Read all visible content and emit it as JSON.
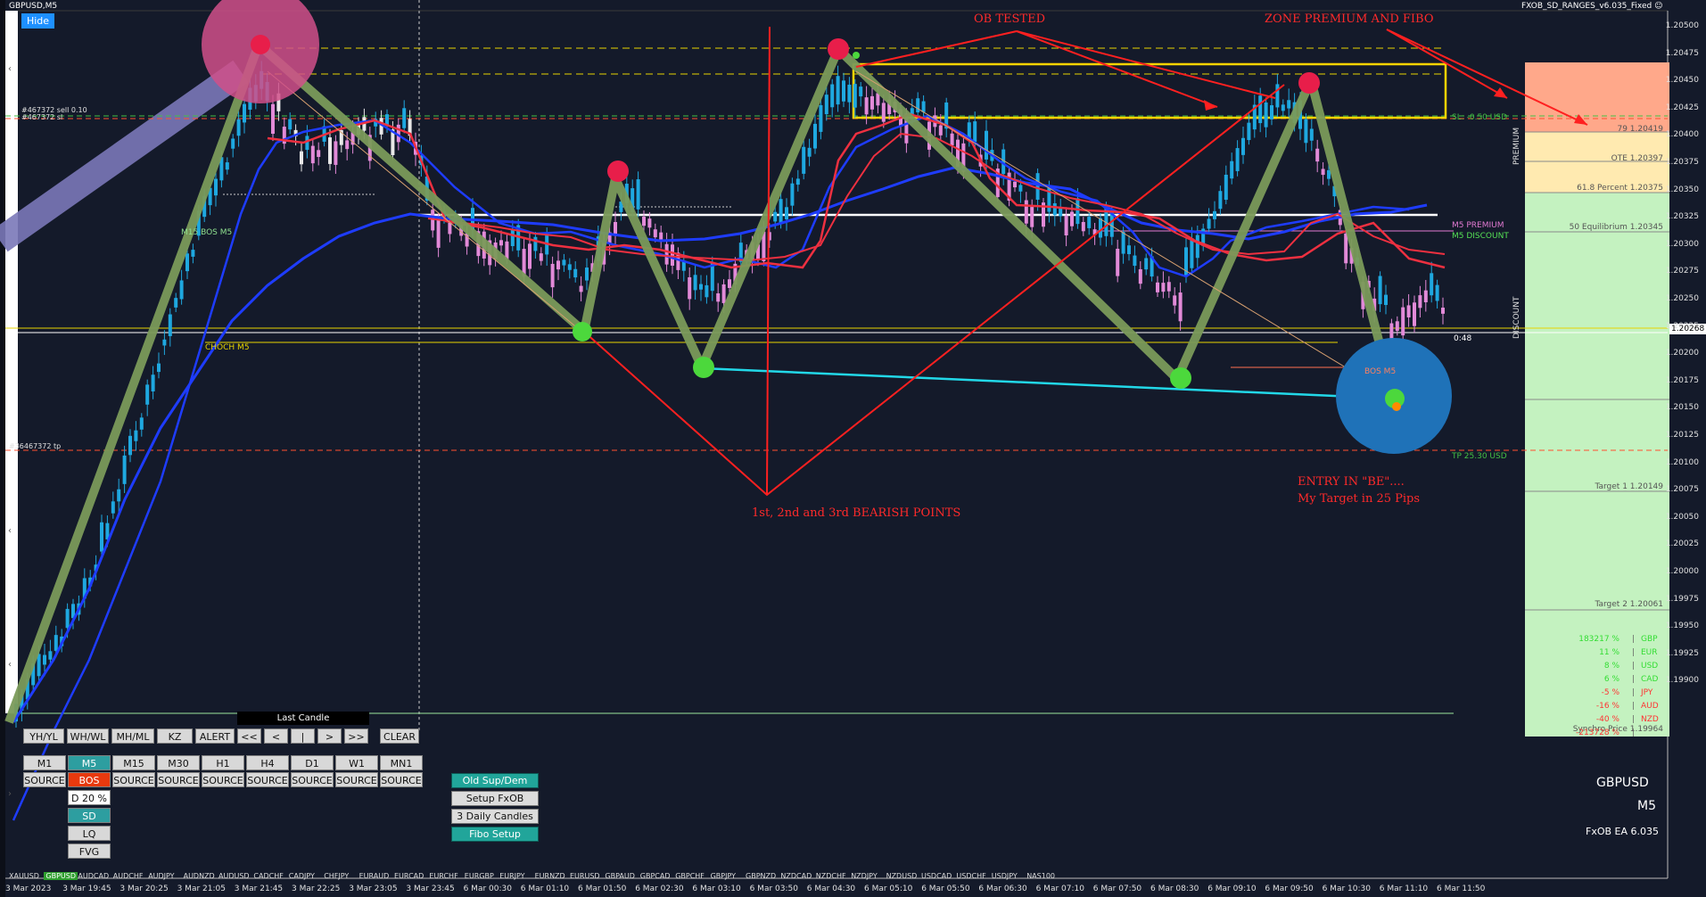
{
  "header": {
    "chart_title": "GBPUSD,M5",
    "ea_name": "FXOB_SD_RANGES_v6.035_Fixed",
    "hide_label": "Hide"
  },
  "annotations": {
    "ob_tested": "OB TESTED",
    "zone_premium": "ZONE PREMIUM AND FIBO",
    "bearish_points": "1st, 2nd and 3rd BEARISH POINTS",
    "entry_line1": "ENTRY IN \"BE\"....",
    "entry_line2": "My Target in 25 Pips"
  },
  "chart_labels": {
    "sell_order": "#467372 sell 0.10",
    "sell_order_sl": "#467372 sl",
    "tp_order": "#36467372 tp",
    "m15_bos": "M15 BOS M5",
    "choch": "CHOCH M5",
    "m5_premium": "M5 PREMIUM",
    "m5_discount": "M5 DISCOUNT",
    "sl_usd": "SL: -0.50 USD",
    "tp_usd": "TP 25.30 USD",
    "bos_m5": "BOS M5",
    "timer": "0:48",
    "premium_vert": "PREMIUM",
    "discount_vert": "DISCOUNT"
  },
  "fibo_levels": [
    {
      "label": "79  1.20419"
    },
    {
      "label": "OTE  1.20397"
    },
    {
      "label": "61.8 Percent  1.20375"
    },
    {
      "label": "50 Equilibrium  1.20345"
    },
    {
      "label": "Target 1  1.20149"
    },
    {
      "label": "Target 2  1.20061"
    },
    {
      "label": "Synchro Price  1.19964"
    }
  ],
  "currency_strength": [
    {
      "value": "183217 %",
      "currency": "GBP",
      "color": "#33dd33"
    },
    {
      "value": "11 %",
      "currency": "EUR",
      "color": "#33dd33"
    },
    {
      "value": "8 %",
      "currency": "USD",
      "color": "#33dd33"
    },
    {
      "value": "6 %",
      "currency": "CAD",
      "color": "#33dd33"
    },
    {
      "value": "-5 %",
      "currency": "JPY",
      "color": "#ff3333"
    },
    {
      "value": "-16 %",
      "currency": "AUD",
      "color": "#ff3333"
    },
    {
      "value": "-40 %",
      "currency": "NZD",
      "color": "#ff3333"
    },
    {
      "value": "-213728 %",
      "currency": "",
      "color": "#ff3333"
    }
  ],
  "price_axis": {
    "labels": [
      "1.20500",
      "1.20475",
      "1.20450",
      "1.20425",
      "1.20400",
      "1.20375",
      "1.20350",
      "1.20325",
      "1.20300",
      "1.20275",
      "1.20250",
      "1.20225",
      "1.20200",
      "1.20175",
      "1.20150",
      "1.20125",
      "1.20100",
      "1.20075",
      "1.20050",
      "1.20025",
      "1.20000",
      "1.19975",
      "1.19950",
      "1.19925",
      "1.19900"
    ],
    "current_price": "1.20268"
  },
  "time_axis": {
    "labels": [
      "3 Mar 2023",
      "3 Mar 19:45",
      "3 Mar 20:25",
      "3 Mar 21:05",
      "3 Mar 21:45",
      "3 Mar 22:25",
      "3 Mar 23:05",
      "3 Mar 23:45",
      "6 Mar 00:30",
      "6 Mar 01:10",
      "6 Mar 01:50",
      "6 Mar 02:30",
      "6 Mar 03:10",
      "6 Mar 03:50",
      "6 Mar 04:30",
      "6 Mar 05:10",
      "6 Mar 05:50",
      "6 Mar 06:30",
      "6 Mar 07:10",
      "6 Mar 07:50",
      "6 Mar 08:30",
      "6 Mar 09:10",
      "6 Mar 09:50",
      "6 Mar 10:30",
      "6 Mar 11:10",
      "6 Mar 11:50"
    ]
  },
  "symbols": [
    "XAUUSD",
    "GBPUSD",
    "AUDCAD",
    "AUDCHF",
    "AUDJPY",
    "AUDNZD",
    "AUDUSD",
    "CADCHF",
    "CADJPY",
    "CHFJPY",
    "EURAUD",
    "EURCAD",
    "EURCHF",
    "EURGBP",
    "EURJPY",
    "EURNZD",
    "EURUSD",
    "GBPAUD",
    "GBPCAD",
    "GBPCHF",
    "GBPJPY",
    "GBPNZD",
    "NZDCAD",
    "NZDCHF",
    "NZDJPY",
    "NZDUSD",
    "USDCAD",
    "USDCHF",
    "USDJPY",
    "NAS100"
  ],
  "active_symbol": "GBPUSD",
  "panel": {
    "last_candle": "Last Candle",
    "nav_buttons": [
      "YH/YL",
      "WH/WL",
      "MH/ML",
      "KZ",
      "ALERT",
      "<<",
      "<",
      "|",
      ">",
      ">>",
      "CLEAR"
    ],
    "timeframes": [
      "M1",
      "M5",
      "M15",
      "M30",
      "H1",
      "H4",
      "D1",
      "W1",
      "MN1"
    ],
    "source_buttons": [
      "SOURCE",
      "BOS",
      "SOURCE",
      "SOURCE",
      "SOURCE",
      "SOURCE",
      "SOURCE",
      "SOURCE",
      "SOURCE"
    ],
    "mode_buttons": [
      "D 20 %",
      "SD",
      "LQ",
      "FVG"
    ],
    "right_buttons": [
      "Old Sup/Dem",
      "Setup FxOB",
      "3 Daily Candles",
      "Fibo Setup"
    ]
  },
  "symbol_box": {
    "pair": "GBPUSD",
    "tf": "M5",
    "ea": "FxOB EA 6.035"
  },
  "colors": {
    "background": "#141a2a",
    "bull": "#1fa8e0",
    "bear": "#e28ad8",
    "zigzag": "#6b8f4e",
    "annotation": "#ff2222"
  }
}
